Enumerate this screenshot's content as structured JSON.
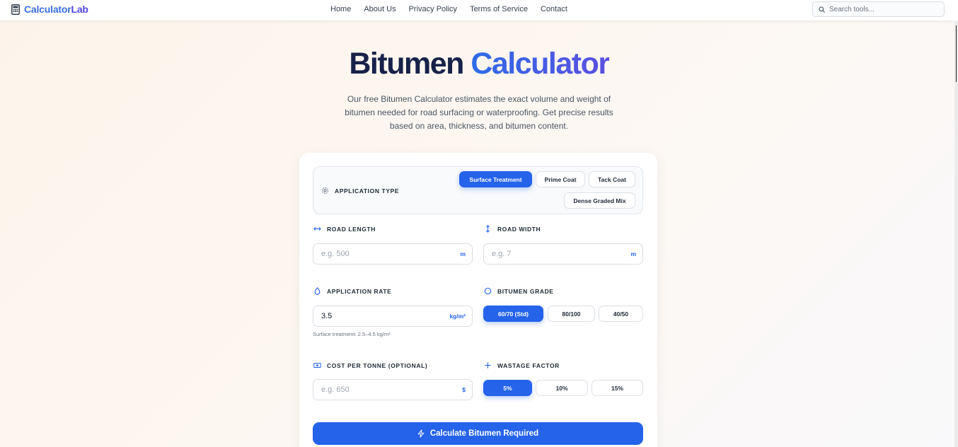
{
  "nav": {
    "logo_part1": "Calculator",
    "logo_part2": "Lab",
    "links": [
      "Home",
      "About Us",
      "Privacy Policy",
      "Terms of Service",
      "Contact"
    ],
    "search_placeholder": "Search tools..."
  },
  "hero": {
    "title_part1": "Bitumen",
    "title_part2": "Calculator",
    "subtitle": "Our free Bitumen Calculator estimates the exact volume and weight of bitumen needed for road surfacing or waterproofing. Get precise results based on area, thickness, and bitumen content."
  },
  "form": {
    "application_type": {
      "label": "APPLICATION TYPE",
      "options": [
        "Surface Treatment",
        "Prime Coat",
        "Tack Coat",
        "Dense Graded Mix"
      ],
      "selected": "Surface Treatment"
    },
    "road_length": {
      "label": "ROAD LENGTH",
      "placeholder": "e.g. 500",
      "value": "",
      "unit": "m"
    },
    "road_width": {
      "label": "ROAD WIDTH",
      "placeholder": "e.g. 7",
      "value": "",
      "unit": "m"
    },
    "application_rate": {
      "label": "APPLICATION RATE",
      "value": "3.5",
      "unit": "kg/m²",
      "hint": "Surface treatment: 2.5–4.5 kg/m²"
    },
    "bitumen_grade": {
      "label": "BITUMEN GRADE",
      "options": [
        "60/70 (Std)",
        "80/100",
        "40/50"
      ],
      "selected": "60/70 (Std)"
    },
    "cost_per_tonne": {
      "label": "COST PER TONNE (OPTIONAL)",
      "placeholder": "e.g. 650",
      "value": "",
      "unit": "$"
    },
    "wastage_factor": {
      "label": "WASTAGE FACTOR",
      "options": [
        "5%",
        "10%",
        "15%"
      ],
      "selected": "5%"
    },
    "calculate_label": "Calculate Bitumen Required"
  },
  "colors": {
    "accent": "#2563eb",
    "title_dark": "#17224a"
  }
}
